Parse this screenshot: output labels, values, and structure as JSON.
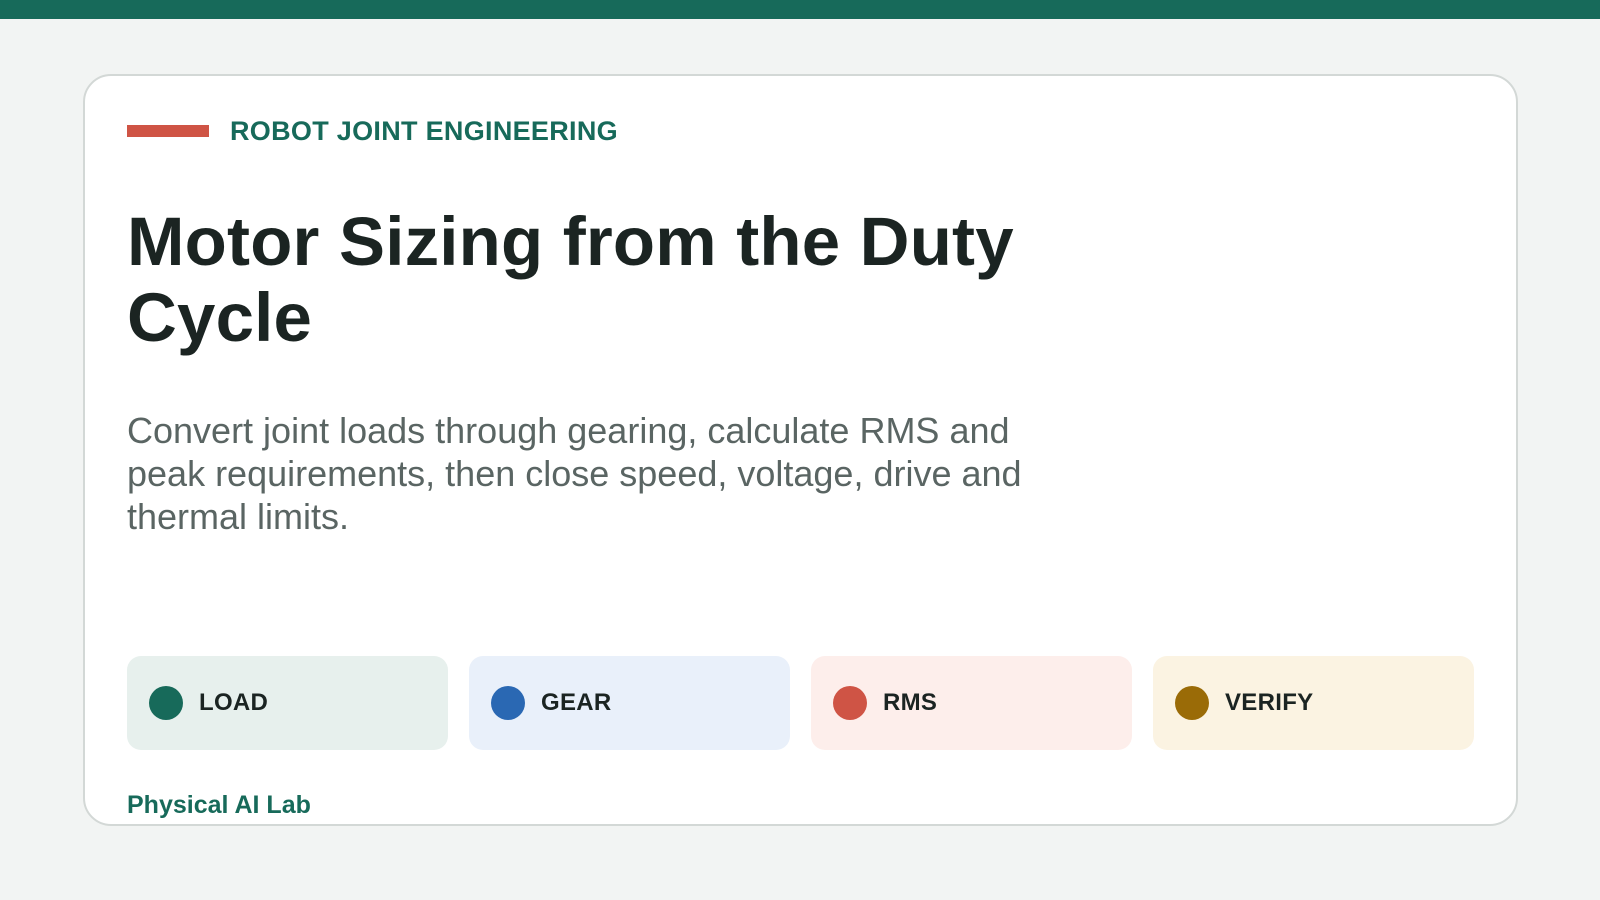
{
  "eyebrow": {
    "text": "ROBOT JOINT ENGINEERING",
    "accent_color": "#cf5445"
  },
  "title": "Motor Sizing from the Duty Cycle",
  "subtitle": "Convert joint loads through gearing, calculate RMS and peak requirements, then close speed, voltage, drive and thermal limits.",
  "chips": [
    {
      "label": "LOAD",
      "dot_color": "#176a5a",
      "bg_color": "#e7f0ed"
    },
    {
      "label": "GEAR",
      "dot_color": "#2a68b3",
      "bg_color": "#e9f0fa"
    },
    {
      "label": "RMS",
      "dot_color": "#cf5445",
      "bg_color": "#fdeeeb"
    },
    {
      "label": "VERIFY",
      "dot_color": "#9a6b07",
      "bg_color": "#fbf3e2"
    }
  ],
  "footer": "Physical AI Lab",
  "theme": {
    "brand_color": "#176a5a",
    "page_bg": "#f2f4f3",
    "card_bg": "#ffffff"
  }
}
